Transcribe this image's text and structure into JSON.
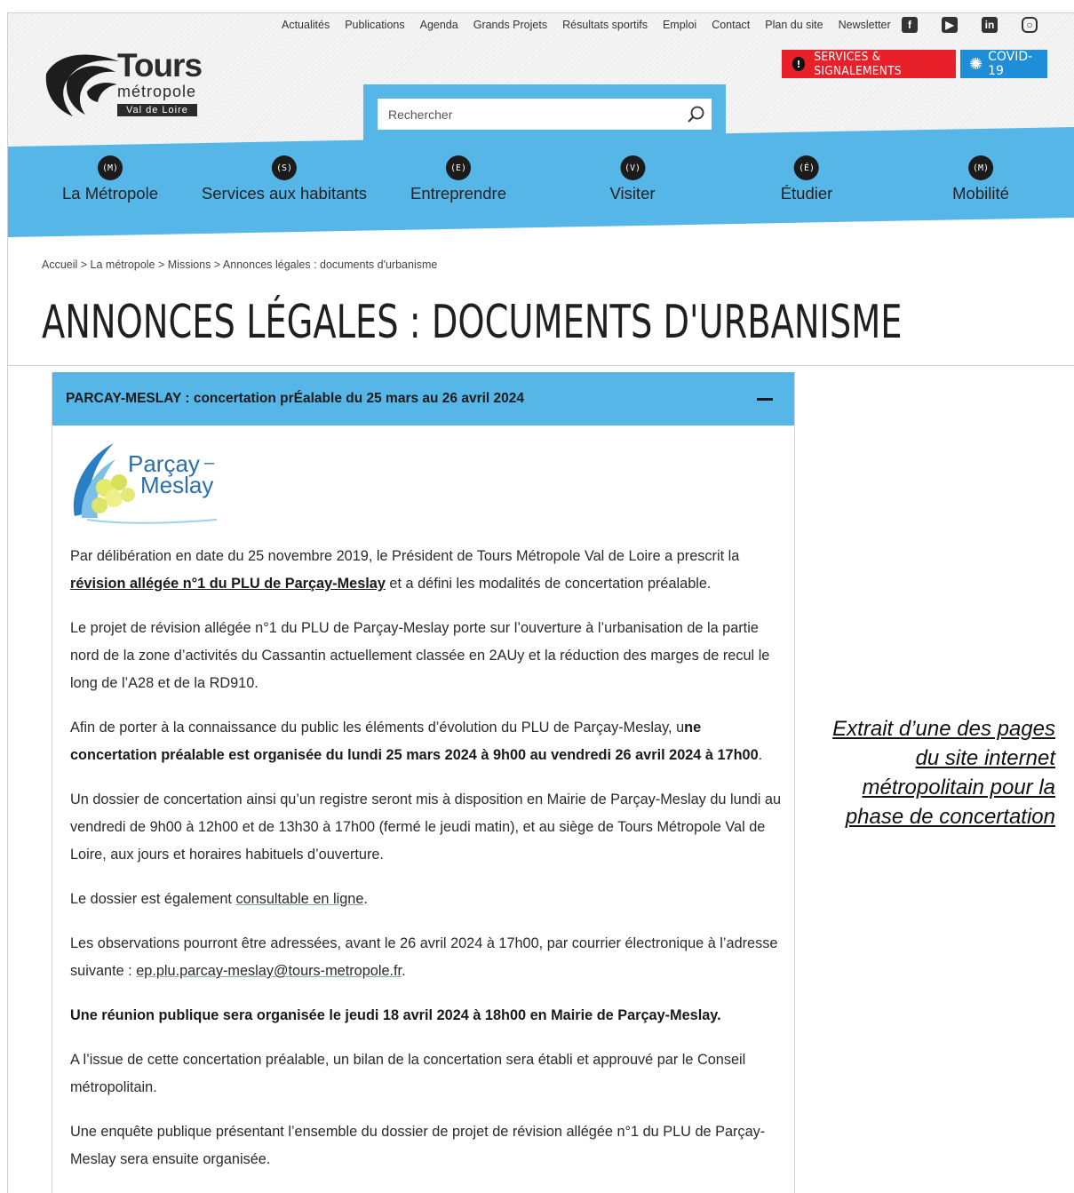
{
  "top_nav": {
    "links": [
      "Actualités",
      "Publications",
      "Agenda",
      "Grands Projets",
      "Résultats sportifs",
      "Emploi",
      "Contact",
      "Plan du site",
      "Newsletter"
    ]
  },
  "social_icons": [
    "facebook-icon",
    "youtube-icon",
    "linkedin-icon",
    "instagram-icon"
  ],
  "logo": {
    "name": "Tours",
    "sub": "métropole",
    "tag": "Val de Loire"
  },
  "buttons": {
    "services": "SERVICES & SIGNALEMENTS",
    "covid": "COVID-19"
  },
  "search": {
    "placeholder": "Rechercher"
  },
  "main_nav": [
    {
      "badge": "(M)",
      "label": "La Métropole"
    },
    {
      "badge": "(S)",
      "label": "Services aux habitants"
    },
    {
      "badge": "(E)",
      "label": "Entreprendre"
    },
    {
      "badge": "(V)",
      "label": "Visiter"
    },
    {
      "badge": "(É)",
      "label": "Étudier"
    },
    {
      "badge": "(M)",
      "label": "Mobilité"
    }
  ],
  "breadcrumb": "Accueil > La métropole > Missions > Annonces légales : documents d'urbanisme",
  "page_title": "ANNONCES LÉGALES : DOCUMENTS D'URBANISME",
  "accordion": {
    "title": "PARCAY-MESLAY : concertation prÉalable du 25 mars au 26 avril 2024",
    "town_logo": {
      "line1": "Parçay",
      "line2": "Meslay"
    },
    "p1_a": "Par délibération en date du 25 novembre 2019, le Président de Tours Métropole Val de Loire a prescrit la ",
    "p1_link": "révision allégée n°1 du PLU de Parçay-Meslay",
    "p1_b": " et a défini les modalités de concertation préalable.",
    "p2": "Le projet de révision allégée n°1 du PLU de Parçay-Meslay porte sur l’ouverture à l’urbanisation de la partie nord de la zone d’activités du Cassantin actuellement classée en 2AUy et la réduction des marges de recul le long de l’A28 et de la RD910.",
    "p3_a": "Afin de porter à la connaissance du public les éléments d’évolution du PLU de Parçay-Meslay, u",
    "p3_b": "ne concertation préalable est organisée du lundi 25 mars 2024 à 9h00 au vendredi 26 avril 2024 à 17h00",
    "p3_c": ".",
    "p4": "Un dossier de concertation ainsi qu’un registre seront mis à disposition en Mairie de Parçay-Meslay du lundi au vendredi de 9h00 à 12h00 et de 13h30 à 17h00 (fermé le jeudi matin), et au siège de Tours Métropole Val de Loire, aux jours et horaires habituels d’ouverture.",
    "p5_a": "Le dossier est également ",
    "p5_link": "consultable en ligne",
    "p5_b": ".",
    "p6_a": "Les observations pourront être adressées, avant le 26 avril 2024 à 17h00, par courrier électronique à l’adresse suivante : ",
    "p6_link": "ep.plu.parcay-meslay@tours-metropole.fr",
    "p6_b": ".",
    "p7": "Une réunion publique sera organisée le jeudi 18 avril 2024 à 18h00 en Mairie de Parçay-Meslay.",
    "p8": "A l’issue de cette concertation préalable, un bilan de la concertation sera établi et approuvé par le Conseil métropolitain.",
    "p9": "Une enquête publique présentant l’ensemble du dossier de projet de révision allégée n°1 du PLU de Parçay-Meslay sera ensuite organisée."
  },
  "caption": "Extrait d’une des pages du site internet métropolitain pour la phase de concertation",
  "colors": {
    "accent_blue": "#56b6e8",
    "services_red": "#e8202a",
    "covid_blue": "#1e8ed8"
  }
}
